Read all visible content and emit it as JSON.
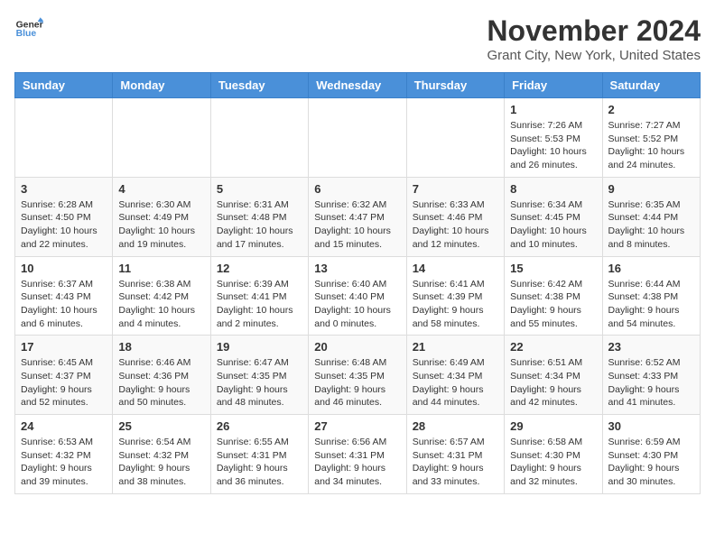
{
  "header": {
    "logo_line1": "General",
    "logo_line2": "Blue",
    "month_title": "November 2024",
    "location": "Grant City, New York, United States"
  },
  "weekdays": [
    "Sunday",
    "Monday",
    "Tuesday",
    "Wednesday",
    "Thursday",
    "Friday",
    "Saturday"
  ],
  "weeks": [
    [
      {
        "day": "",
        "info": ""
      },
      {
        "day": "",
        "info": ""
      },
      {
        "day": "",
        "info": ""
      },
      {
        "day": "",
        "info": ""
      },
      {
        "day": "",
        "info": ""
      },
      {
        "day": "1",
        "info": "Sunrise: 7:26 AM\nSunset: 5:53 PM\nDaylight: 10 hours and 26 minutes."
      },
      {
        "day": "2",
        "info": "Sunrise: 7:27 AM\nSunset: 5:52 PM\nDaylight: 10 hours and 24 minutes."
      }
    ],
    [
      {
        "day": "3",
        "info": "Sunrise: 6:28 AM\nSunset: 4:50 PM\nDaylight: 10 hours and 22 minutes."
      },
      {
        "day": "4",
        "info": "Sunrise: 6:30 AM\nSunset: 4:49 PM\nDaylight: 10 hours and 19 minutes."
      },
      {
        "day": "5",
        "info": "Sunrise: 6:31 AM\nSunset: 4:48 PM\nDaylight: 10 hours and 17 minutes."
      },
      {
        "day": "6",
        "info": "Sunrise: 6:32 AM\nSunset: 4:47 PM\nDaylight: 10 hours and 15 minutes."
      },
      {
        "day": "7",
        "info": "Sunrise: 6:33 AM\nSunset: 4:46 PM\nDaylight: 10 hours and 12 minutes."
      },
      {
        "day": "8",
        "info": "Sunrise: 6:34 AM\nSunset: 4:45 PM\nDaylight: 10 hours and 10 minutes."
      },
      {
        "day": "9",
        "info": "Sunrise: 6:35 AM\nSunset: 4:44 PM\nDaylight: 10 hours and 8 minutes."
      }
    ],
    [
      {
        "day": "10",
        "info": "Sunrise: 6:37 AM\nSunset: 4:43 PM\nDaylight: 10 hours and 6 minutes."
      },
      {
        "day": "11",
        "info": "Sunrise: 6:38 AM\nSunset: 4:42 PM\nDaylight: 10 hours and 4 minutes."
      },
      {
        "day": "12",
        "info": "Sunrise: 6:39 AM\nSunset: 4:41 PM\nDaylight: 10 hours and 2 minutes."
      },
      {
        "day": "13",
        "info": "Sunrise: 6:40 AM\nSunset: 4:40 PM\nDaylight: 10 hours and 0 minutes."
      },
      {
        "day": "14",
        "info": "Sunrise: 6:41 AM\nSunset: 4:39 PM\nDaylight: 9 hours and 58 minutes."
      },
      {
        "day": "15",
        "info": "Sunrise: 6:42 AM\nSunset: 4:38 PM\nDaylight: 9 hours and 55 minutes."
      },
      {
        "day": "16",
        "info": "Sunrise: 6:44 AM\nSunset: 4:38 PM\nDaylight: 9 hours and 54 minutes."
      }
    ],
    [
      {
        "day": "17",
        "info": "Sunrise: 6:45 AM\nSunset: 4:37 PM\nDaylight: 9 hours and 52 minutes."
      },
      {
        "day": "18",
        "info": "Sunrise: 6:46 AM\nSunset: 4:36 PM\nDaylight: 9 hours and 50 minutes."
      },
      {
        "day": "19",
        "info": "Sunrise: 6:47 AM\nSunset: 4:35 PM\nDaylight: 9 hours and 48 minutes."
      },
      {
        "day": "20",
        "info": "Sunrise: 6:48 AM\nSunset: 4:35 PM\nDaylight: 9 hours and 46 minutes."
      },
      {
        "day": "21",
        "info": "Sunrise: 6:49 AM\nSunset: 4:34 PM\nDaylight: 9 hours and 44 minutes."
      },
      {
        "day": "22",
        "info": "Sunrise: 6:51 AM\nSunset: 4:34 PM\nDaylight: 9 hours and 42 minutes."
      },
      {
        "day": "23",
        "info": "Sunrise: 6:52 AM\nSunset: 4:33 PM\nDaylight: 9 hours and 41 minutes."
      }
    ],
    [
      {
        "day": "24",
        "info": "Sunrise: 6:53 AM\nSunset: 4:32 PM\nDaylight: 9 hours and 39 minutes."
      },
      {
        "day": "25",
        "info": "Sunrise: 6:54 AM\nSunset: 4:32 PM\nDaylight: 9 hours and 38 minutes."
      },
      {
        "day": "26",
        "info": "Sunrise: 6:55 AM\nSunset: 4:31 PM\nDaylight: 9 hours and 36 minutes."
      },
      {
        "day": "27",
        "info": "Sunrise: 6:56 AM\nSunset: 4:31 PM\nDaylight: 9 hours and 34 minutes."
      },
      {
        "day": "28",
        "info": "Sunrise: 6:57 AM\nSunset: 4:31 PM\nDaylight: 9 hours and 33 minutes."
      },
      {
        "day": "29",
        "info": "Sunrise: 6:58 AM\nSunset: 4:30 PM\nDaylight: 9 hours and 32 minutes."
      },
      {
        "day": "30",
        "info": "Sunrise: 6:59 AM\nSunset: 4:30 PM\nDaylight: 9 hours and 30 minutes."
      }
    ]
  ]
}
